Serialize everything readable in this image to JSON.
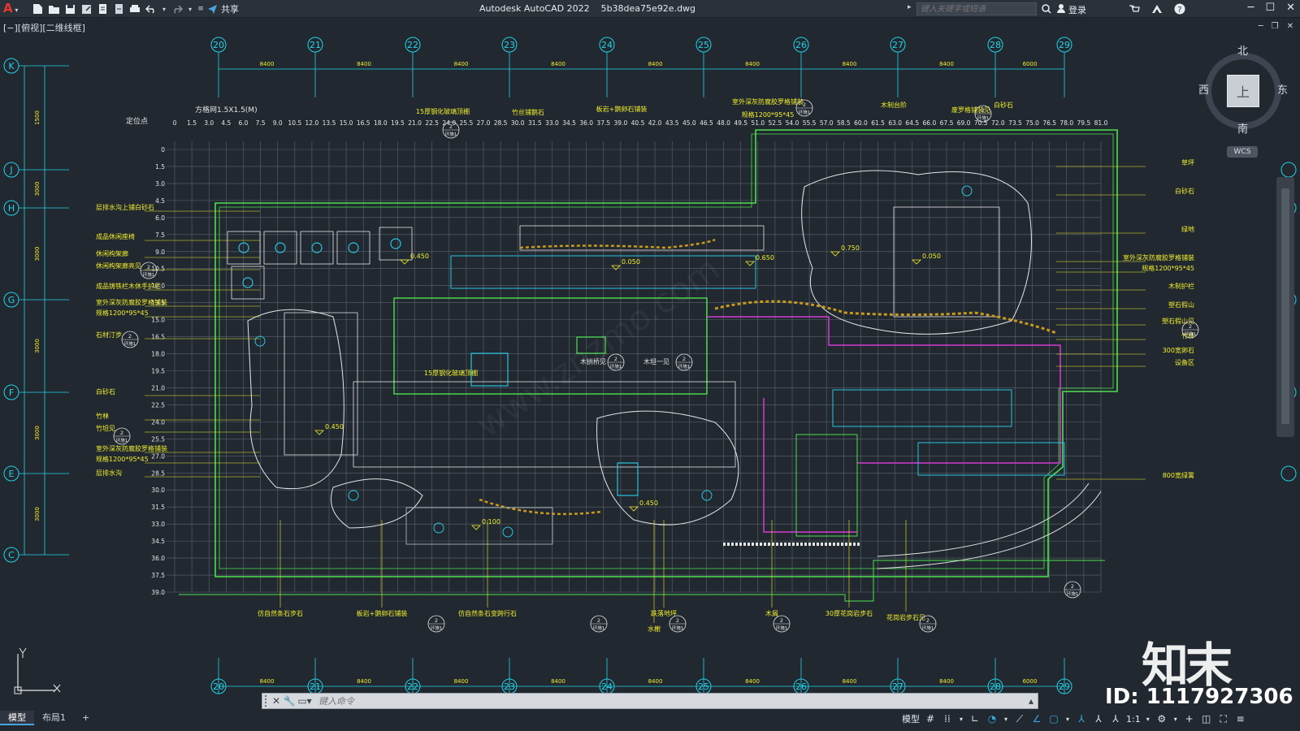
{
  "app": {
    "title": "Autodesk AutoCAD 2022    5b38dea75e92e.dwg",
    "logo": "A",
    "share_label": "共享",
    "search_placeholder": "键入关键字或短语",
    "login_label": "登录",
    "accent": "#e8352e"
  },
  "viewport": {
    "label": "[−][俯视][二维线框]"
  },
  "viewcube": {
    "north": "北",
    "south": "南",
    "east": "东",
    "west": "西",
    "face": "上",
    "wcs": "WCS"
  },
  "drawing": {
    "grid_label": "方格网1.5X1.5(M)",
    "locate_label": "定位点",
    "col_axes": [
      "20",
      "21",
      "22",
      "23",
      "24",
      "25",
      "26",
      "27",
      "28",
      "29"
    ],
    "col_dims": [
      "8400",
      "8400",
      "8400",
      "8400",
      "8400",
      "8400",
      "8400",
      "8400",
      "6000"
    ],
    "row_axes": [
      "K",
      "J",
      "H",
      "G",
      "F",
      "E",
      "C"
    ],
    "row_dims": [
      "1500",
      "3000",
      "3000",
      "3000",
      "3000",
      "3000",
      "3000",
      "3000"
    ],
    "x_ticks": [
      "0",
      "1.5",
      "3.0",
      "4.5",
      "6.0",
      "7.5",
      "9.0",
      "10.5",
      "12.0",
      "13.5",
      "15.0",
      "16.5",
      "18.0",
      "19.5",
      "21.0",
      "22.5",
      "24.0",
      "25.5",
      "27.0",
      "28.5",
      "30.0",
      "31.5",
      "33.0",
      "34.5",
      "36.0",
      "37.5",
      "39.0",
      "40.5",
      "42.0",
      "43.5",
      "45.0",
      "46.5",
      "48.0",
      "49.5",
      "51.0",
      "52.5",
      "54.0",
      "55.5",
      "57.0",
      "58.5",
      "60.0",
      "61.5",
      "63.0",
      "64.5",
      "66.0",
      "67.5",
      "69.0",
      "70.5",
      "72.0",
      "73.5",
      "75.0",
      "76.5",
      "78.0",
      "79.5",
      "81.0"
    ],
    "y_ticks": [
      "0",
      "1.5",
      "3.0",
      "4.5",
      "6.0",
      "7.5",
      "9.0",
      "10.5",
      "12.0",
      "13.5",
      "15.0",
      "16.5",
      "18.0",
      "19.5",
      "21.0",
      "22.5",
      "24.0",
      "25.5",
      "27.0",
      "28.5",
      "30.0",
      "31.5",
      "33.0",
      "34.5",
      "36.0",
      "37.5",
      "39.0"
    ],
    "left_labels": [
      "层排水沟上铺白砂石",
      "成品休闲座椅",
      "休闲构架廊",
      "休闲构架廊亮见",
      "成品铸铁栏木休手护栏",
      "室外深灰防腐胶罗格铺装",
      "规格1200*95*45",
      "石材汀步",
      "白砂石",
      "竹林",
      "竹坦见",
      "室外深灰防腐胶罗格铺装",
      "规格1200*95*45",
      "层排水沟"
    ],
    "right_labels": [
      "草坪",
      "白砂石",
      "绿地",
      "室外深灰防腐胶罗格铺装",
      "规格1200*95*45",
      "木制护栏",
      "塑石假山",
      "塑石假山见",
      "竹林",
      "300宽卵石",
      "设备区",
      "800宽绿篱"
    ],
    "top_labels": [
      "15厚钢化玻璃顶棚",
      "竹丝铺鹅石",
      "板岩+鹅卵石铺装",
      "室外深灰防腐胶罗格铺装",
      "规格1200*95*45",
      "木制台阶",
      "废罗格铺装见",
      "白砂石"
    ],
    "bottom_labels": [
      "仿自然条石步石",
      "板岩+鹅卵石铺装",
      "仿自然条石变跨行石",
      "跌落地坪",
      "水榭",
      "木屑",
      "30厚花岗岩步石",
      "花岗岩步石见"
    ],
    "inner_labels": [
      "15厚钢化玻璃顶棚",
      "木拱桥见",
      "木坦一见"
    ],
    "levels": [
      "0.450",
      "0.050",
      "0.650",
      "0.750",
      "0.050",
      "0.450",
      "0.450",
      "0.100"
    ],
    "detail_ref": "2",
    "detail_sheet": "环施1",
    "colors": {
      "axis": "#22d3e8",
      "boundary": "#4de04d",
      "text": "#f1ee2a",
      "grid": "#5b6470",
      "structure": "#28c5e0",
      "magenta": "#d43ad4",
      "gravel": "#c79a1e",
      "background": "#212830"
    }
  },
  "cmdline": {
    "placeholder": "键入命令"
  },
  "layout_tabs": [
    "模型",
    "布局1",
    "+"
  ],
  "status": {
    "model_label": "模型",
    "scale_label": "1:1"
  },
  "watermark": {
    "logo": "知末",
    "id_text": "ID: 1117927306",
    "site": "www.znzmo.com"
  }
}
